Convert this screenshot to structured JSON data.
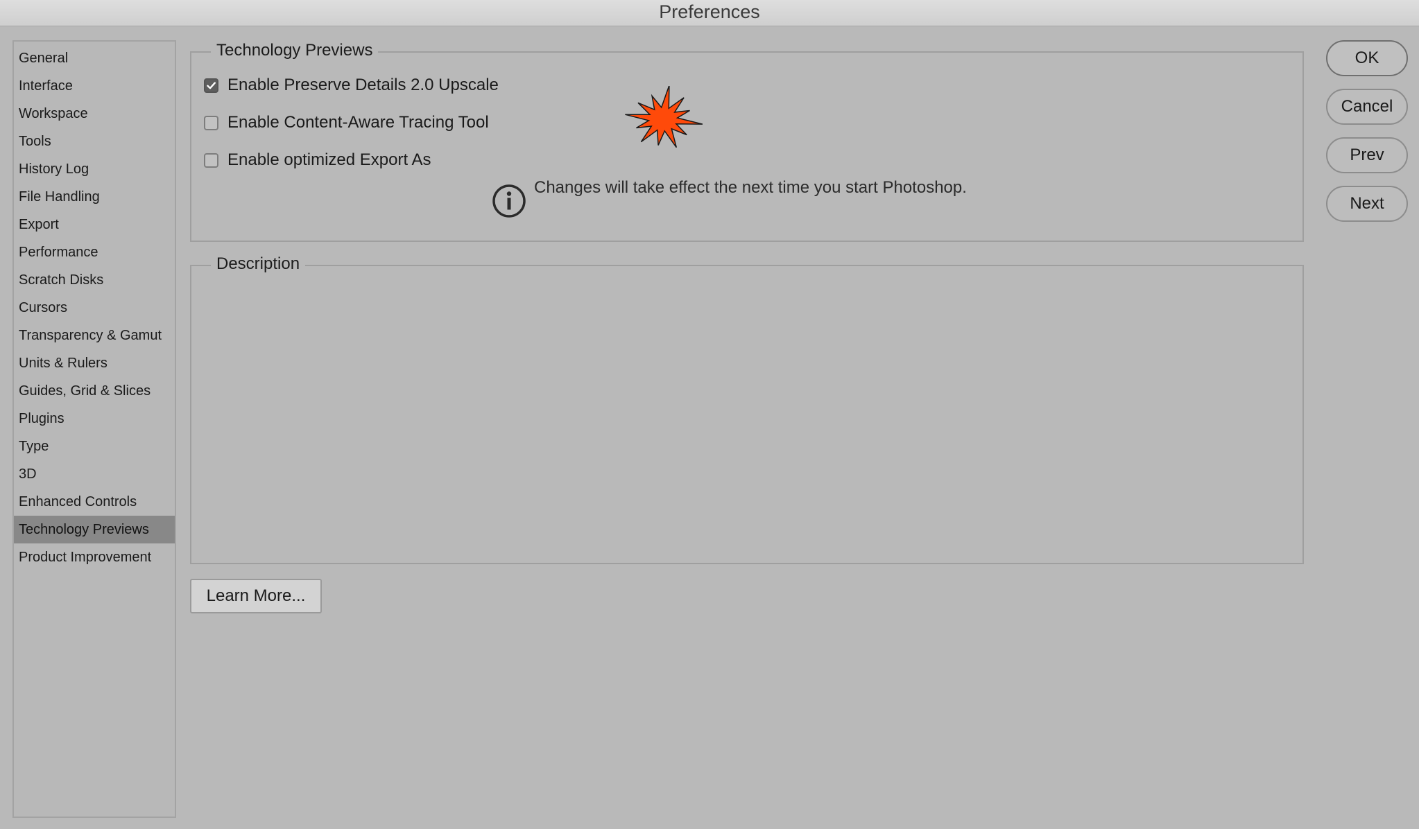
{
  "window": {
    "title": "Preferences"
  },
  "sidebar": {
    "items": [
      {
        "label": "General"
      },
      {
        "label": "Interface"
      },
      {
        "label": "Workspace"
      },
      {
        "label": "Tools"
      },
      {
        "label": "History Log"
      },
      {
        "label": "File Handling"
      },
      {
        "label": "Export"
      },
      {
        "label": "Performance"
      },
      {
        "label": "Scratch Disks"
      },
      {
        "label": "Cursors"
      },
      {
        "label": "Transparency & Gamut"
      },
      {
        "label": "Units & Rulers"
      },
      {
        "label": "Guides, Grid & Slices"
      },
      {
        "label": "Plugins"
      },
      {
        "label": "Type"
      },
      {
        "label": "3D"
      },
      {
        "label": "Enhanced Controls"
      },
      {
        "label": "Technology Previews"
      },
      {
        "label": "Product Improvement"
      }
    ],
    "selected": "Technology Previews"
  },
  "tech_previews": {
    "title": "Technology Previews",
    "options": [
      {
        "label": "Enable Preserve Details 2.0 Upscale",
        "checked": true
      },
      {
        "label": "Enable Content-Aware Tracing Tool",
        "checked": false
      },
      {
        "label": "Enable optimized Export As",
        "checked": false
      }
    ],
    "info_text": "Changes will take effect the next time you start Photoshop.",
    "info_icon": "info-circle-icon",
    "highlight_color": "#ff4a0a"
  },
  "description": {
    "title": "Description",
    "text": ""
  },
  "learn_more": {
    "label": "Learn More..."
  },
  "buttons": {
    "ok": "OK",
    "cancel": "Cancel",
    "prev": "Prev",
    "next": "Next"
  }
}
